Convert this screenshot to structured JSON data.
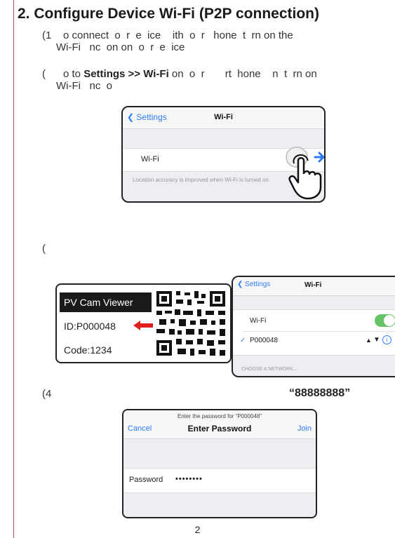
{
  "heading": "2. Configure Device Wi-Fi (P2P connection)",
  "steps": {
    "s1_line1": "(1    o connect  o  r  e  ice    ith  o  r   hone  t  rn on the",
    "s1_line2": "Wi-Fi   nc  on on  o  r  e  ice",
    "s2_prefix": "(      o to ",
    "s2_bold": "Settings >> Wi-Fi",
    "s2_rest": " on  o  r       rt  hone    n  t  rn on",
    "s2_line2": "Wi-Fi   nc  o",
    "s3": "(",
    "s4": "(4",
    "s4_password": "“88888888”"
  },
  "screen1": {
    "back": "Settings",
    "title": "Wi-Fi",
    "cell_label": "Wi-Fi",
    "footnote": "Location accuracy is improved when Wi-Fi is turned on."
  },
  "card": {
    "app_name": "PV Cam Viewer",
    "id_text": "ID:P000048",
    "code_text": "Code:1234",
    "accent": "#e02020"
  },
  "screen2": {
    "back": "Settings",
    "title": "Wi-Fi",
    "cell_label": "Wi-Fi",
    "network": "P000048",
    "section": "CHOOSE A NETWORK..."
  },
  "screen3": {
    "prompt": "Enter the password for “P000048”",
    "cancel": "Cancel",
    "title": "Enter Password",
    "join": "Join",
    "field_label": "Password",
    "field_value": "••••••••"
  },
  "page_number": "2",
  "colors": {
    "ios_blue": "#2d7cf6",
    "toggle_green": "#66c466",
    "border_accent": "#b25a45"
  }
}
